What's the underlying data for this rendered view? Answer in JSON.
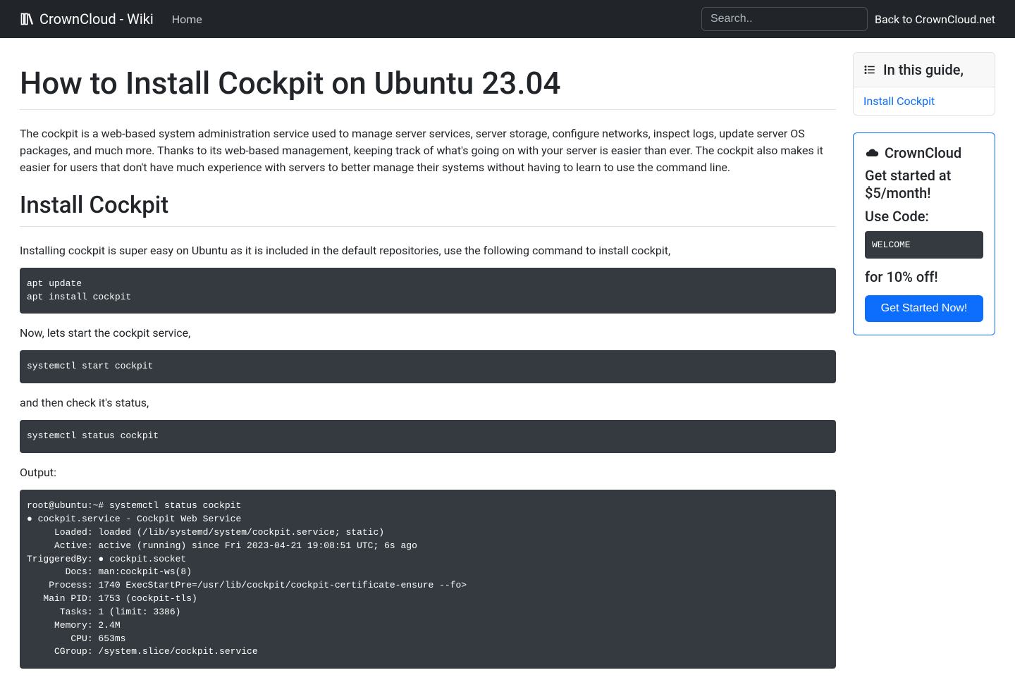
{
  "nav": {
    "brand": "CrownCloud - Wiki",
    "home": "Home",
    "search_placeholder": "Search..",
    "back": "Back to CrownCloud.net"
  },
  "page": {
    "title": "How to Install Cockpit on Ubuntu 23.04",
    "intro": "The cockpit is a web-based system administration service used to manage server services, server storage, configure networks, inspect logs, update server OS packages, and much more. Thanks to its web-based management, keeping track of what's going on with your server is easier than ever. The cockpit also makes it easier for users that don't have much experience with servers to better manage their systems without having to learn to use the command line.",
    "h2": "Install Cockpit",
    "p1": "Installing cockpit is super easy on Ubuntu as it is included in the default repositories, use the following command to install cockpit,",
    "code1": "apt update\napt install cockpit",
    "p2": "Now, lets start the cockpit service,",
    "code2": "systemctl start cockpit",
    "p3": "and then check it's status,",
    "code3": "systemctl status cockpit",
    "p4": "Output:",
    "code4": "root@ubuntu:~# systemctl status cockpit\n● cockpit.service - Cockpit Web Service\n     Loaded: loaded (/lib/systemd/system/cockpit.service; static)\n     Active: active (running) since Fri 2023-04-21 19:08:51 UTC; 6s ago\nTriggeredBy: ● cockpit.socket\n       Docs: man:cockpit-ws(8)\n    Process: 1740 ExecStartPre=/usr/lib/cockpit/cockpit-certificate-ensure --fo>\n   Main PID: 1753 (cockpit-tls)\n      Tasks: 1 (limit: 3386)\n     Memory: 2.4M\n        CPU: 653ms\n     CGroup: /system.slice/cockpit.service"
  },
  "toc": {
    "header": "In this guide,",
    "items": [
      "Install Cockpit"
    ]
  },
  "promo": {
    "title": "CrownCloud",
    "line1": "Get started at $5/month!",
    "use_code": "Use Code:",
    "code": "WELCOME",
    "off": "for 10% off!",
    "cta": "Get Started Now!"
  }
}
